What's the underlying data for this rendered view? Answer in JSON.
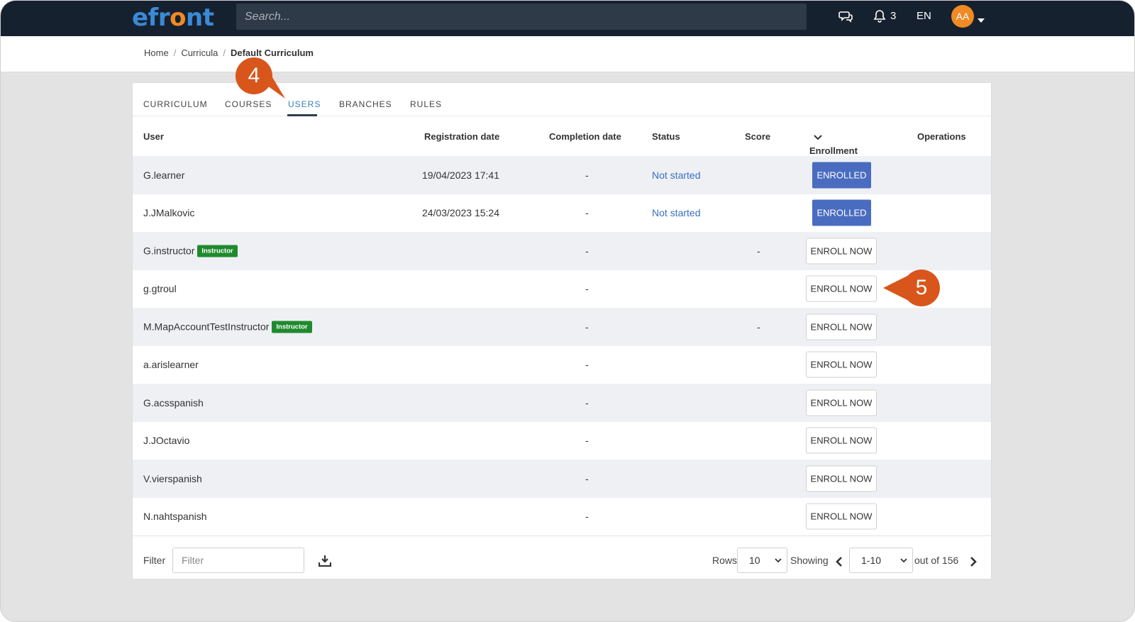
{
  "header": {
    "logo_left": "efr",
    "logo_o": "o",
    "logo_right": "nt",
    "search_placeholder": "Search...",
    "notifications_count": "3",
    "language": "EN",
    "avatar_initials": "AA"
  },
  "breadcrumb": {
    "items": [
      "Home",
      "Curricula"
    ],
    "current": "Default Curriculum"
  },
  "tabs": [
    "CURRICULUM",
    "COURSES",
    "USERS",
    "BRANCHES",
    "RULES"
  ],
  "active_tab": "USERS",
  "table": {
    "columns": [
      "User",
      "Registration date",
      "Completion date",
      "Status",
      "Score",
      "Enrollment",
      "Operations"
    ],
    "rows": [
      {
        "user": "G.learner",
        "badge": "",
        "registration": "19/04/2023 17:41",
        "completion": "-",
        "status": "Not started",
        "score": "",
        "enrollment": "ENROLLED"
      },
      {
        "user": "J.JMalkovic",
        "badge": "",
        "registration": "24/03/2023 15:24",
        "completion": "-",
        "status": "Not started",
        "score": "",
        "enrollment": "ENROLLED"
      },
      {
        "user": "G.instructor",
        "badge": "Instructor",
        "registration": "",
        "completion": "-",
        "status": "",
        "score": "-",
        "enrollment": "ENROLL NOW"
      },
      {
        "user": "g.gtroul",
        "badge": "",
        "registration": "",
        "completion": "-",
        "status": "",
        "score": "",
        "enrollment": "ENROLL NOW"
      },
      {
        "user": "M.MapAccountTestInstructor",
        "badge": "Instructor",
        "registration": "",
        "completion": "-",
        "status": "",
        "score": "-",
        "enrollment": "ENROLL NOW"
      },
      {
        "user": "a.arislearner",
        "badge": "",
        "registration": "",
        "completion": "-",
        "status": "",
        "score": "",
        "enrollment": "ENROLL NOW"
      },
      {
        "user": "G.acsspanish",
        "badge": "",
        "registration": "",
        "completion": "-",
        "status": "",
        "score": "",
        "enrollment": "ENROLL NOW"
      },
      {
        "user": "J.JOctavio",
        "badge": "",
        "registration": "",
        "completion": "-",
        "status": "",
        "score": "",
        "enrollment": "ENROLL NOW"
      },
      {
        "user": "V.vierspanish",
        "badge": "",
        "registration": "",
        "completion": "-",
        "status": "",
        "score": "",
        "enrollment": "ENROLL NOW"
      },
      {
        "user": "N.nahtspanish",
        "badge": "",
        "registration": "",
        "completion": "-",
        "status": "",
        "score": "",
        "enrollment": "ENROLL NOW"
      }
    ]
  },
  "footer": {
    "filter_label": "Filter",
    "filter_placeholder": "Filter",
    "rows_label": "Rows",
    "rows_value": "10",
    "showing_label": "Showing",
    "range_value": "1-10",
    "total_text": "out of 156"
  },
  "annotations": [
    "4",
    "5"
  ],
  "colors": {
    "topbar": "#162130",
    "accent_blue": "#3a8ad6",
    "accent_orange": "#f08a24",
    "enrolled_button": "#4a6cc0",
    "instructor_badge": "#1f8a2e",
    "marker": "#d8561c"
  }
}
